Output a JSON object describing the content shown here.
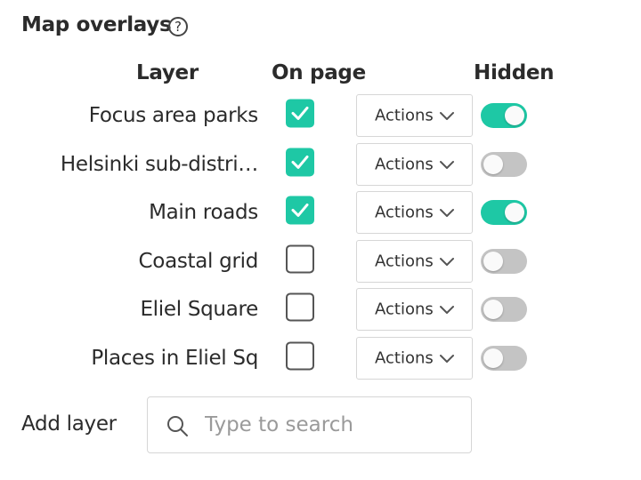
{
  "panel": {
    "title": "Map overlays",
    "help_icon": "question-circle-icon",
    "help_glyph": "?"
  },
  "table": {
    "headers": {
      "layer": "Layer",
      "on_page": "On page",
      "hidden": "Hidden"
    },
    "rows": [
      {
        "name": "Focus area parks",
        "on_page": true,
        "actions_label": "Actions",
        "hidden": true
      },
      {
        "name": "Helsinki sub-distri…",
        "on_page": true,
        "actions_label": "Actions",
        "hidden": false
      },
      {
        "name": "Main roads",
        "on_page": true,
        "actions_label": "Actions",
        "hidden": true
      },
      {
        "name": "Coastal grid",
        "on_page": false,
        "actions_label": "Actions",
        "hidden": false
      },
      {
        "name": "Eliel Square",
        "on_page": false,
        "actions_label": "Actions",
        "hidden": false
      },
      {
        "name": "Places in Eliel Sq",
        "on_page": false,
        "actions_label": "Actions",
        "hidden": false
      }
    ]
  },
  "add_layer": {
    "label": "Add layer",
    "search_placeholder": "Type to search",
    "search_value": ""
  },
  "colors": {
    "accent": "#1ec8a5",
    "toggle_off": "#c4c4c4",
    "text": "#2b2b2b",
    "placeholder": "#9a9a9a",
    "border": "#d6d6d6"
  },
  "icons": {
    "check": "check-icon",
    "chevron": "chevron-down-icon",
    "search": "search-icon"
  }
}
